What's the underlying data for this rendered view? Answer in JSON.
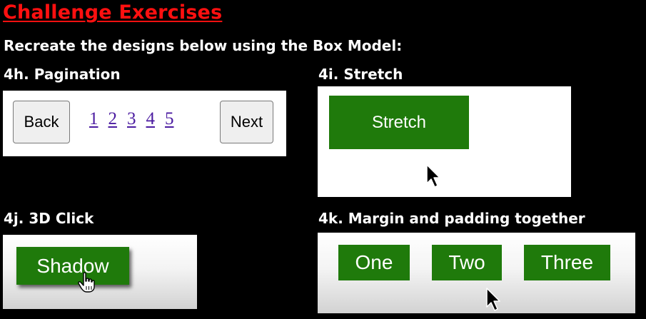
{
  "heading": "Challenge Exercises",
  "subheading": "Recreate the designs below using the Box Model:",
  "sections": {
    "pagination": {
      "label": "4h. Pagination",
      "back_label": "Back",
      "pages": [
        "1",
        "2",
        "3",
        "4",
        "5"
      ],
      "next_label": "Next"
    },
    "stretch": {
      "label": "4i. Stretch",
      "button_label": "Stretch"
    },
    "click3d": {
      "label": "4j. 3D Click",
      "button_label": "Shadow"
    },
    "margin_padding": {
      "label": "4k. Margin and padding together",
      "buttons": [
        "One",
        "Two",
        "Three"
      ]
    }
  },
  "colors": {
    "heading": "#ff1010",
    "button_green": "#1f7a0b",
    "link_purple": "#4a1aa0",
    "background": "#000000"
  },
  "icons": {
    "arrow_cursor": "arrow-cursor-icon",
    "hand_cursor": "hand-pointer-icon"
  }
}
